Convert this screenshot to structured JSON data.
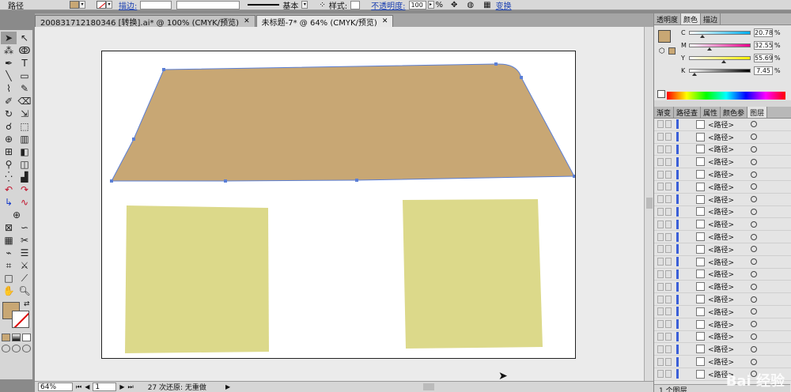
{
  "control_bar": {
    "object_type": "路径",
    "stroke_label": "描边:",
    "stroke_style": "基本",
    "style_label": "样式:",
    "opacity_label": "不透明度:",
    "opacity_value": "100",
    "opacity_unit": "%",
    "transform_link": "变换"
  },
  "tabs": [
    {
      "label": "200831712180346 [转换].ai* @ 100% (CMYK/预览)",
      "close": "✕"
    },
    {
      "label": "未标题-7* @ 64% (CMYK/预览)",
      "close": "✕"
    }
  ],
  "status_bar": {
    "zoom": "64%",
    "page": "1",
    "history": "27 次还原: 无重做"
  },
  "panels": {
    "top_tabs": [
      "透明度",
      "颜色",
      "描边"
    ],
    "color_values": {
      "C": "20.78",
      "M": "32.55",
      "Y": "55.69",
      "K": "7.45"
    },
    "color_levels": {
      "C": 0.2078,
      "M": 0.3255,
      "Y": 0.5569,
      "K": 0.0745
    },
    "lower_tabs": [
      "渐变",
      "路径查",
      "属性",
      "颜色参",
      "图层"
    ],
    "layer_items": [
      "<路径>",
      "<路径>",
      "<路径>",
      "<路径>",
      "<路径>",
      "<路径>",
      "<路径>",
      "<路径>",
      "<路径>",
      "<路径>",
      "<路径>",
      "<路径>",
      "<路径>",
      "<路径>",
      "<路径>",
      "<路径>",
      "<路径>",
      "<路径>",
      "<路径>",
      "<路径>",
      "<路径>"
    ],
    "layers_footer": "1 个图层"
  },
  "colors": {
    "roof": "#c8a774",
    "window": "#dcd98a",
    "path": "#5b7fd6"
  }
}
